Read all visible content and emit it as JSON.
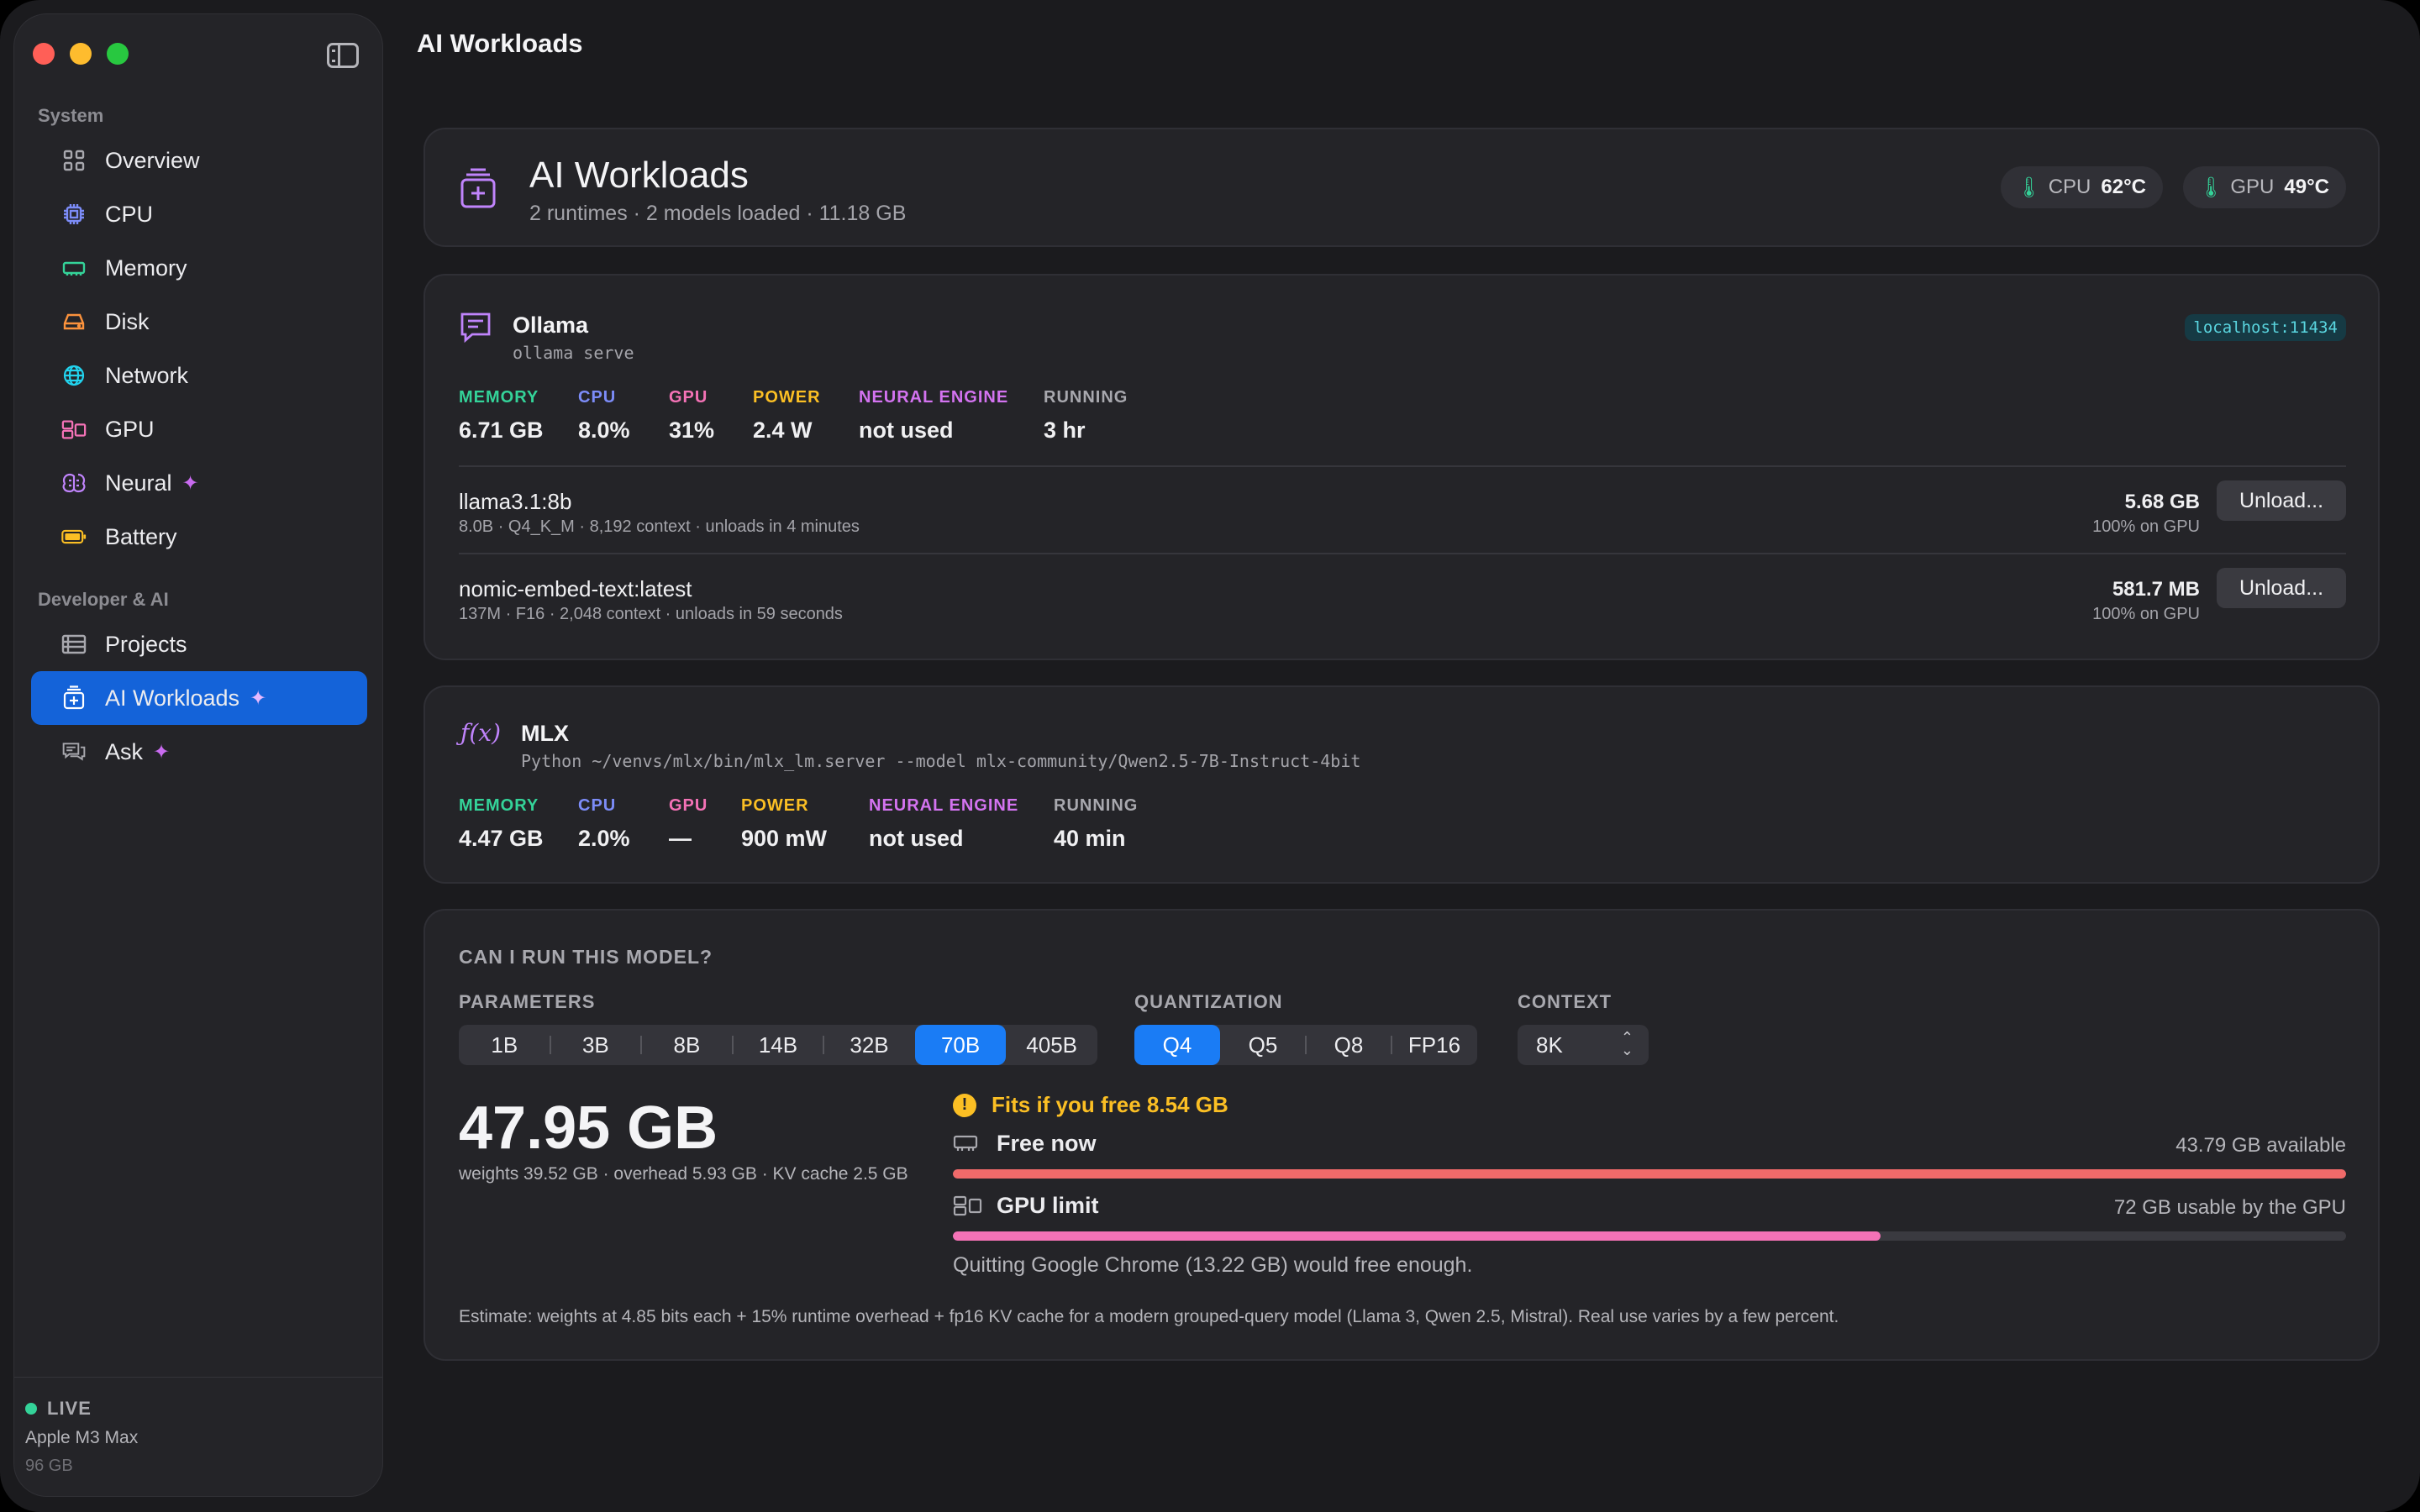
{
  "colors": {
    "accent": "#1463d9",
    "segment_selected": "#1a7cf5",
    "memory_label": "#34d399",
    "cpu_label": "#7c8cf8",
    "gpu_label": "#f472b6",
    "power_label": "#fbbf24",
    "neural_label": "#d373f0",
    "running_label": "#a8a8ae",
    "warning": "#fbbf24",
    "free_bar": "#f06a6a",
    "gpu_bar": "#f472b6",
    "live_dot": "#34d399"
  },
  "sidebar": {
    "section_system": "System",
    "system_items": [
      {
        "label": "Overview",
        "icon": "grid-icon"
      },
      {
        "label": "CPU",
        "icon": "cpu-icon"
      },
      {
        "label": "Memory",
        "icon": "memory-icon"
      },
      {
        "label": "Disk",
        "icon": "disk-icon"
      },
      {
        "label": "Network",
        "icon": "globe-icon"
      },
      {
        "label": "GPU",
        "icon": "gpu-icon"
      },
      {
        "label": "Neural",
        "icon": "brain-icon",
        "sparkle": true
      },
      {
        "label": "Battery",
        "icon": "battery-icon"
      }
    ],
    "section_dev": "Developer & AI",
    "dev_items": [
      {
        "label": "Projects",
        "icon": "projects-icon"
      },
      {
        "label": "AI Workloads",
        "icon": "ai-workloads-icon",
        "sparkle": true,
        "active": true
      },
      {
        "label": "Ask",
        "icon": "chat-icon",
        "sparkle": true
      }
    ],
    "footer": {
      "status": "LIVE",
      "chip": "Apple M3 Max",
      "memory": "96 GB"
    }
  },
  "header": {
    "title": "AI Workloads"
  },
  "hero": {
    "title": "AI Workloads",
    "subtitle": "2 runtimes · 2 models loaded · 11.18 GB",
    "cpu_label": "CPU",
    "cpu_temp": "62°C",
    "gpu_label": "GPU",
    "gpu_temp": "49°C"
  },
  "runtimes": {
    "ollama": {
      "name": "Ollama",
      "command": "ollama serve",
      "host": "localhost:11434",
      "metrics": {
        "memory_label": "MEMORY",
        "memory": "6.71 GB",
        "cpu_label": "CPU",
        "cpu": "8.0%",
        "gpu_label": "GPU",
        "gpu": "31%",
        "power_label": "POWER",
        "power": "2.4 W",
        "neural_label": "NEURAL ENGINE",
        "neural": "not used",
        "running_label": "RUNNING",
        "running": "3 hr"
      },
      "models": [
        {
          "name": "llama3.1:8b",
          "meta": "8.0B · Q4_K_M · 8,192 context · unloads in 4 minutes",
          "size": "5.68 GB",
          "gpu": "100% on GPU",
          "action": "Unload..."
        },
        {
          "name": "nomic-embed-text:latest",
          "meta": "137M · F16 · 2,048 context · unloads in 59 seconds",
          "size": "581.7 MB",
          "gpu": "100% on GPU",
          "action": "Unload..."
        }
      ]
    },
    "mlx": {
      "name": "MLX",
      "command": "Python ~/venvs/mlx/bin/mlx_lm.server --model mlx-community/Qwen2.5-7B-Instruct-4bit",
      "metrics": {
        "memory_label": "MEMORY",
        "memory": "4.47 GB",
        "cpu_label": "CPU",
        "cpu": "2.0%",
        "gpu_label": "GPU",
        "gpu": "—",
        "power_label": "POWER",
        "power": "900 mW",
        "neural_label": "NEURAL ENGINE",
        "neural": "not used",
        "running_label": "RUNNING",
        "running": "40 min"
      }
    }
  },
  "calculator": {
    "title": "CAN I RUN THIS MODEL?",
    "parameters_label": "PARAMETERS",
    "parameters": [
      "1B",
      "3B",
      "8B",
      "14B",
      "32B",
      "70B",
      "405B"
    ],
    "parameters_selected": "70B",
    "quantization_label": "QUANTIZATION",
    "quantization": [
      "Q4",
      "Q5",
      "Q8",
      "FP16"
    ],
    "quantization_selected": "Q4",
    "context_label": "CONTEXT",
    "context_value": "8K",
    "total": "47.95 GB",
    "breakdown": "weights 39.52 GB · overhead 5.93 GB · KV cache 2.5 GB",
    "verdict": "Fits if you free 8.54 GB",
    "free_now_label": "Free now",
    "free_now_value": "43.79 GB available",
    "free_now_fraction": 1.0,
    "gpu_limit_label": "GPU limit",
    "gpu_limit_value": "72 GB usable by the GPU",
    "gpu_limit_fraction": 0.666,
    "suggestion": "Quitting Google Chrome (13.22 GB) would free enough.",
    "footnote": "Estimate: weights at 4.85 bits each + 15% runtime overhead + fp16 KV cache for a modern grouped-query model (Llama 3, Qwen 2.5, Mistral). Real use varies by a few percent."
  }
}
